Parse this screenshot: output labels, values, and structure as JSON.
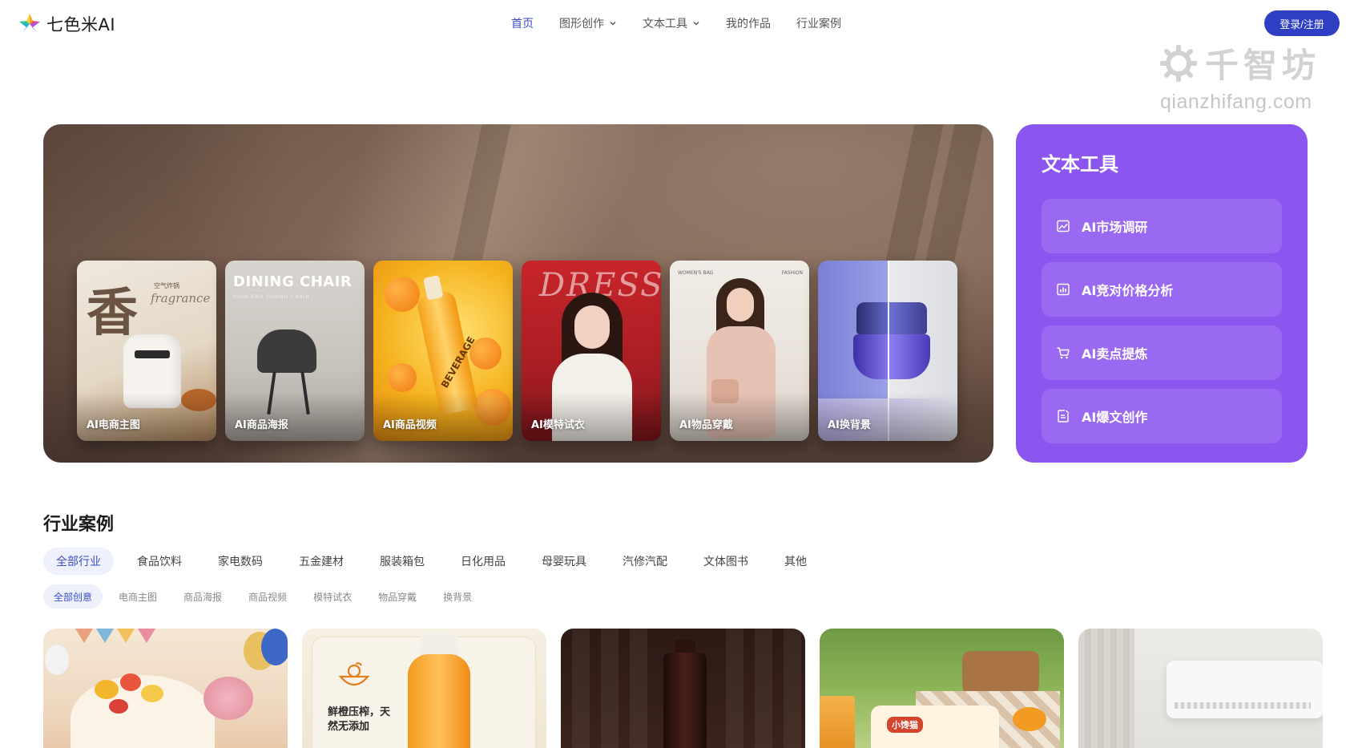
{
  "brand": {
    "name": "七色米AI"
  },
  "nav": {
    "items": [
      {
        "label": "首页",
        "active": true,
        "has_dropdown": false
      },
      {
        "label": "图形创作",
        "active": false,
        "has_dropdown": true
      },
      {
        "label": "文本工具",
        "active": false,
        "has_dropdown": true
      },
      {
        "label": "我的作品",
        "active": false,
        "has_dropdown": false
      },
      {
        "label": "行业案例",
        "active": false,
        "has_dropdown": false
      }
    ],
    "login_label": "登录/注册"
  },
  "watermark": {
    "title": "千智坊",
    "subtitle": "qianzhifang.com"
  },
  "hero": {
    "cards": [
      {
        "label": "AI电商主图",
        "art_text": [
          "香",
          "fragrance",
          "空气炸锅"
        ]
      },
      {
        "label": "AI商品海报",
        "art_text": [
          "DINING CHAIR",
          "HIGH-END DINING CHAIR"
        ]
      },
      {
        "label": "AI商品视频",
        "art_text": [
          "BEVERAGE"
        ]
      },
      {
        "label": "AI模特试衣",
        "art_text": [
          "DRESS"
        ]
      },
      {
        "label": "AI物品穿戴",
        "art_text": [
          "WOMEN'S BAG",
          "FASHION"
        ]
      },
      {
        "label": "AI换背景",
        "art_text": []
      }
    ]
  },
  "text_tools": {
    "title": "文本工具",
    "items": [
      {
        "label": "AI市场调研",
        "icon": "image-chart-icon"
      },
      {
        "label": "AI竞对价格分析",
        "icon": "bar-chart-icon"
      },
      {
        "label": "AI卖点提炼",
        "icon": "cart-icon"
      },
      {
        "label": "AI爆文创作",
        "icon": "document-edit-icon"
      }
    ]
  },
  "cases": {
    "title": "行业案例",
    "industries": [
      "全部行业",
      "食品饮料",
      "家电数码",
      "五金建材",
      "服装箱包",
      "日化用品",
      "母婴玩具",
      "汽修汽配",
      "文体图书",
      "其他"
    ],
    "active_industry": "全部行业",
    "creatives": [
      "全部创意",
      "电商主图",
      "商品海报",
      "商品视频",
      "模特试衣",
      "物品穿戴",
      "换背景"
    ],
    "active_creative": "全部创意",
    "thumbnails": [
      {
        "name": "birthday-cake",
        "art_text": ""
      },
      {
        "name": "orange-juice",
        "art_text": "鲜橙压榨，天然无添加"
      },
      {
        "name": "red-wine",
        "art_text": ""
      },
      {
        "name": "picnic-snack",
        "art_text": "小馋猫"
      },
      {
        "name": "air-conditioner",
        "art_text": ""
      }
    ]
  },
  "colors": {
    "accent": "#2f3fc4",
    "tools_panel": "#8b55f0",
    "hero_background": "#6e5548"
  }
}
